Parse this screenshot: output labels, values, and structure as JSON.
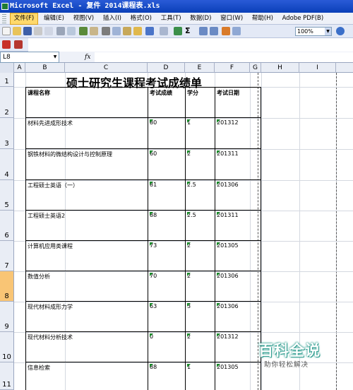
{
  "window": {
    "title": "Microsoft Excel - 复件 2014课程表.xls"
  },
  "menu": [
    {
      "label": "文件(F)"
    },
    {
      "label": "编辑(E)"
    },
    {
      "label": "视图(V)"
    },
    {
      "label": "插入(I)"
    },
    {
      "label": "格式(O)"
    },
    {
      "label": "工具(T)"
    },
    {
      "label": "数据(D)"
    },
    {
      "label": "窗口(W)"
    },
    {
      "label": "帮助(H)"
    },
    {
      "label": "Adobe PDF(B)"
    }
  ],
  "toolbar": {
    "zoom": "100%"
  },
  "formula_bar": {
    "name_box": "L8",
    "fx": "fx",
    "value": ""
  },
  "columns": [
    "A",
    "B",
    "C",
    "D",
    "E",
    "F",
    "G",
    "H",
    "I"
  ],
  "rows": [
    "1",
    "2",
    "3",
    "4",
    "5",
    "6",
    "7",
    "8",
    "9",
    "10",
    "11"
  ],
  "selected_row": "8",
  "sheet": {
    "title": "硕士研究生课程考试成绩单",
    "headers": {
      "course": "课程名称",
      "score": "考试成绩",
      "credit": "学分",
      "date": "考试日期"
    },
    "records": [
      {
        "course": "材料先进成形技术",
        "score": "80",
        "credit": "1",
        "date": "201312"
      },
      {
        "course": "钢铁材料的微结构设计与控制原理",
        "score": "60",
        "credit": "2",
        "date": "201311"
      },
      {
        "course": "工程硕士英语（一）",
        "score": "81",
        "credit": "2.5",
        "date": "201306"
      },
      {
        "course": "工程硕士英语2",
        "score": "88",
        "credit": "2.5",
        "date": "201311"
      },
      {
        "course": "计算机应用类课程",
        "score": "73",
        "credit": "2",
        "date": "201305"
      },
      {
        "course": "数值分析",
        "score": "70",
        "credit": "2",
        "date": "201306"
      },
      {
        "course": "现代材料成形力学",
        "score": "63",
        "credit": "3",
        "date": "201306"
      },
      {
        "course": "现代材料分析技术",
        "score": "0",
        "credit": "2",
        "date": "201312"
      },
      {
        "course": "信息检索",
        "score": "88",
        "credit": "1",
        "date": "201305"
      }
    ]
  },
  "watermark": {
    "logo": "百科全说",
    "tagline": "助你轻松解决"
  }
}
